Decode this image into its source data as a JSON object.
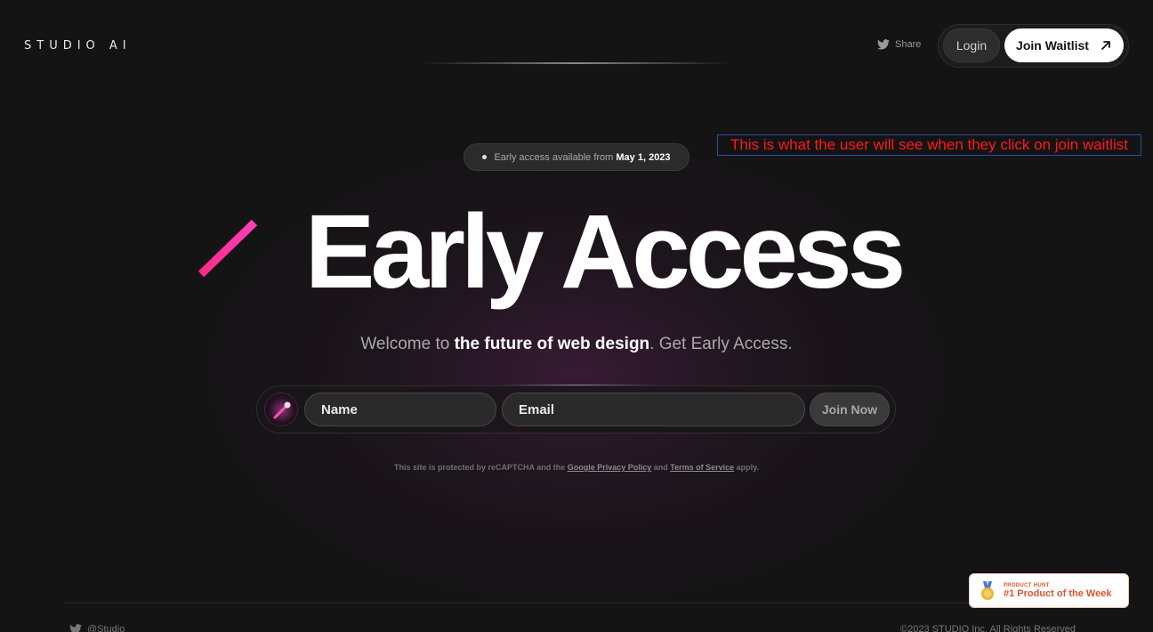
{
  "header": {
    "logo": "STUDIO AI",
    "share_label": "Share",
    "login_label": "Login",
    "waitlist_label": "Join Waitlist"
  },
  "badge": {
    "prefix": "Early access available from",
    "date": "May 1, 2023"
  },
  "annotation": "This is what the user will see when they click on join waitlist",
  "hero": {
    "title": "Early Access",
    "subtitle_pre": "Welcome to ",
    "subtitle_bold": "the future of web design",
    "subtitle_post": ". Get Early Access."
  },
  "form": {
    "name_placeholder": "Name",
    "email_placeholder": "Email",
    "submit_label": "Join Now"
  },
  "legal": {
    "pre": "This site is protected by reCAPTCHA and the ",
    "privacy_link": "Google Privacy Policy",
    "mid": " and ",
    "terms_link": "Terms of Service",
    "post": " apply."
  },
  "footer": {
    "handle": "@Studio",
    "copyright": "©2023 STUDIO Inc. All Rights Reserved"
  },
  "product_hunt": {
    "small": "PRODUCT HUNT",
    "big": "#1 Product of the Week"
  },
  "colors": {
    "background": "#141414",
    "accent_pink": "#ff2d9b",
    "annotation_red": "#ff1a1a",
    "product_hunt": "#da552f"
  },
  "icons": {
    "share": "twitter-icon",
    "waitlist": "arrow-up-right-icon",
    "avatar": "magic-wand-icon",
    "medal": "medal-icon"
  }
}
